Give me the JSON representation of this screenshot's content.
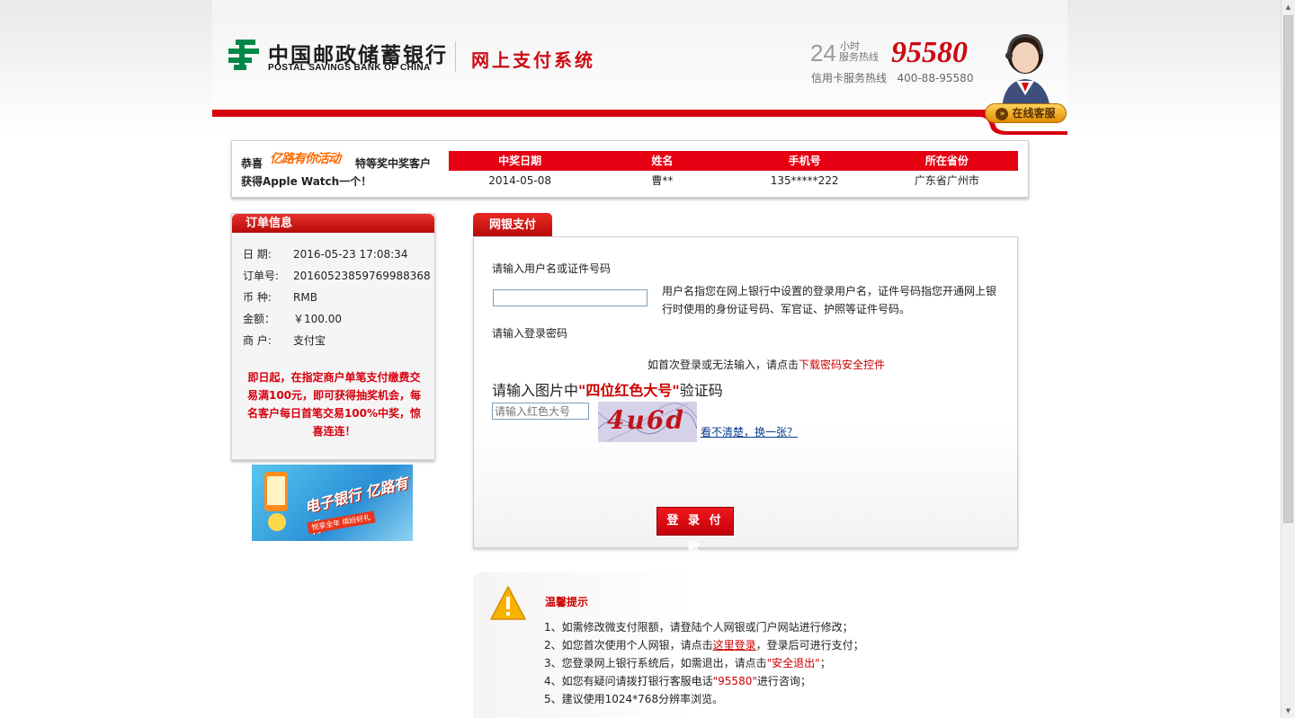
{
  "colors": {
    "brand_red": "#d6000f",
    "link_blue": "#0a3d91",
    "logo_green": "#00884a"
  },
  "header": {
    "bank_name_cn": "中国邮政储蓄银行",
    "bank_name_en": "POSTAL SAVINGS BANK OF CHINA",
    "system_title": "网上支付系统",
    "hotline_24": "24",
    "hotline_small_1": "小时",
    "hotline_small_2": "服务热线",
    "hotline_number": "95580",
    "credit_line": "信用卡服务热线   400-88-95580",
    "online_service": "在线客服"
  },
  "winner": {
    "congrats": "恭喜",
    "promo_name": "亿路有你活动",
    "prize_text": "特等奖中奖客户",
    "prize_text2": "获得Apple Watch一个！",
    "columns": [
      "中奖日期",
      "姓名",
      "手机号",
      "所在省份"
    ],
    "row": [
      "2014-05-08",
      "曹**",
      "135*****222",
      "广东省广州市"
    ]
  },
  "order": {
    "title": "订单信息",
    "rows": [
      {
        "label": "日 期:",
        "value": "2016-05-23 17:08:34"
      },
      {
        "label": "订单号:",
        "value": "20160523859769988368"
      },
      {
        "label": "币 种:",
        "value": "RMB"
      },
      {
        "label": "金额：",
        "value": "￥100.00"
      },
      {
        "label": "商 户:",
        "value": "支付宝"
      }
    ],
    "promo": "即日起，在指定商户单笔支付缴费交易满100元，即可获得抽奖机会，每名客户每日首笔交易100%中奖，惊喜连连！"
  },
  "ad": {
    "main": "电子银行 亿路有你",
    "sub": "悦享全年 缤纷好礼"
  },
  "pay": {
    "tab": "网银支付",
    "username_label": "请输入用户名或证件号码",
    "username_hint": "用户名指您在网上银行中设置的登录用户名，证件号码指您开通网上银行时使用的身份证号码、军官证、护照等证件号码。",
    "password_label": "请输入登录密码",
    "download_prefix": "如首次登录或无法输入，请点击",
    "download_link": "下载密码安全控件",
    "captcha_prefix": "请输入图片中",
    "captcha_emph": "\"四位红色大号\"",
    "captcha_suffix": "验证码",
    "captcha_placeholder": "请输入红色大号",
    "captcha_text": "4u6d",
    "change_link": "看不清楚，换一张？",
    "submit": "登 录 付 款"
  },
  "tips": {
    "title": "温馨提示",
    "l1": "1、如需修改微支付限额，请登陆个人网银或门户网站进行修改；",
    "l2_a": "2、如您首次使用个人网银，请点击",
    "l2_link": "这里登录",
    "l2_b": "，登录后可进行支付；",
    "l3_a": "3、您登录网上银行系统后，如需退出，请点击",
    "l3_link": "\"安全退出\"",
    "l3_b": "；",
    "l4_a": "4、如您有疑问请拨打银行客服电话",
    "l4_red": "\"95580\"",
    "l4_b": "进行咨询；",
    "l5": "5、建议使用1024*768分辨率浏览。"
  },
  "scrollbar": {
    "up": "▲",
    "down": "▼"
  }
}
